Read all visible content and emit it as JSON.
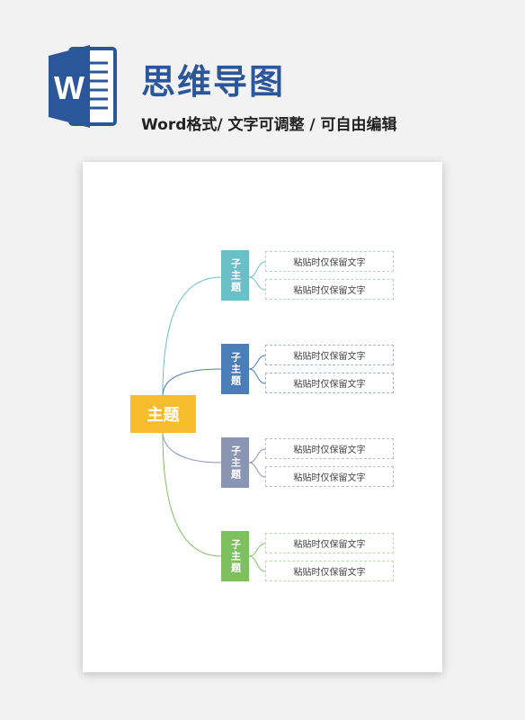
{
  "header": {
    "logo_letter": "W",
    "title": "思维导图",
    "subtitle": "Word格式/ 文字可调整 / 可自由编辑"
  },
  "mindmap": {
    "main_topic": "主题",
    "branches": [
      {
        "label": "子主题",
        "color": "#6bc0c8",
        "leaves": [
          "粘贴时仅保留文字",
          "粘贴时仅保留文字"
        ]
      },
      {
        "label": "子主题",
        "color": "#4a7eb9",
        "leaves": [
          "粘贴时仅保留文字",
          "粘贴时仅保留文字"
        ]
      },
      {
        "label": "子主题",
        "color": "#8a94b3",
        "leaves": [
          "粘贴时仅保留文字",
          "粘贴时仅保留文字"
        ]
      },
      {
        "label": "子主题",
        "color": "#7ec05f",
        "leaves": [
          "粘贴时仅保留文字",
          "粘贴时仅保留文字"
        ]
      }
    ]
  }
}
